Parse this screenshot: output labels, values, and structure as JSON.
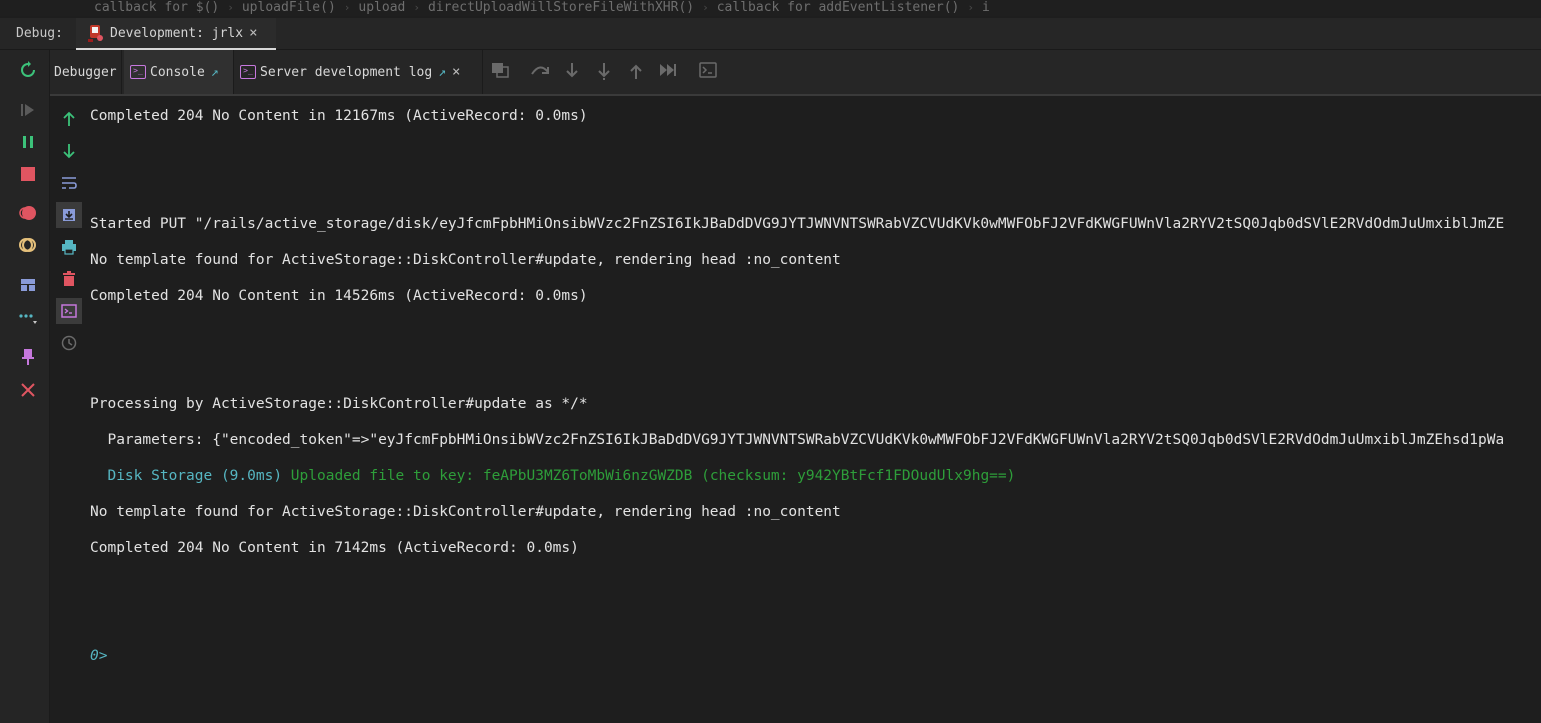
{
  "breadcrumb": {
    "items": [
      "callback for $()",
      "uploadFile()",
      "upload",
      "directUploadWillStoreFileWithXHR()",
      "callback for addEventListener()",
      "i"
    ]
  },
  "debug_bar": {
    "label": "Debug:",
    "tab_title": "Development: jrlx",
    "close_glyph": "×"
  },
  "sub_tabs": {
    "debugger": "Debugger",
    "console": "Console",
    "server_log": "Server development log",
    "close_glyph": "×"
  },
  "console": {
    "lines": {
      "l1": "Completed 204 No Content in 12167ms (ActiveRecord: 0.0ms)",
      "l2": "Started PUT \"/rails/active_storage/disk/eyJfcmFpbHMiOnsibWVzc2FnZSI6IkJBaDdDVG9JYTJWNVNTSWRabVZCVUdKVk0wMWFObFJ2VFdKWGFUWnVla2RYV2tSQ0Jqb0dSVlE2RVdOdmJuUmxiblJmZE",
      "l3": "No template found for ActiveStorage::DiskController#update, rendering head :no_content",
      "l4": "Completed 204 No Content in 14526ms (ActiveRecord: 0.0ms)",
      "l5": "Processing by ActiveStorage::DiskController#update as */*",
      "l6": "  Parameters: {\"encoded_token\"=>\"eyJfcmFpbHMiOnsibWVzc2FnZSI6IkJBaDdDVG9JYTJWNVNTSWRabVZCVUdKVk0wMWFObFJ2VFdKWGFUWnVla2RYV2tSQ0Jqb0dSVlE2RVdOdmJuUmxiblJmZEhsd1pWa",
      "l7_prefix": "  Disk Storage (9.0ms)",
      "l7_msg": " Uploaded file to key: feAPbU3MZ6ToMbWi6nzGWZDB (checksum: y942YBtFcf1FDOudUlx9hg==)",
      "l8": "No template found for ActiveStorage::DiskController#update, rendering head :no_content",
      "l9": "Completed 204 No Content in 7142ms (ActiveRecord: 0.0ms)"
    },
    "prompt": "0>"
  },
  "colors": {
    "accent_teal": "#56b6c2",
    "log_green": "#2e9e3a",
    "stop_red": "#e05561",
    "purple": "#c678dd"
  },
  "icons": {
    "left_bar": [
      "rerun-icon",
      "resume-icon",
      "pause-icon",
      "stop-icon",
      "view-breakpoints-icon",
      "mute-breakpoints-icon",
      "layout-icon",
      "more-icon",
      "pin-icon",
      "close-icon"
    ],
    "gutter": [
      "scroll-up-icon",
      "scroll-down-icon",
      "soft-wrap-icon",
      "scroll-to-end-icon",
      "print-icon",
      "clear-icon",
      "console-icon",
      "history-icon"
    ]
  }
}
